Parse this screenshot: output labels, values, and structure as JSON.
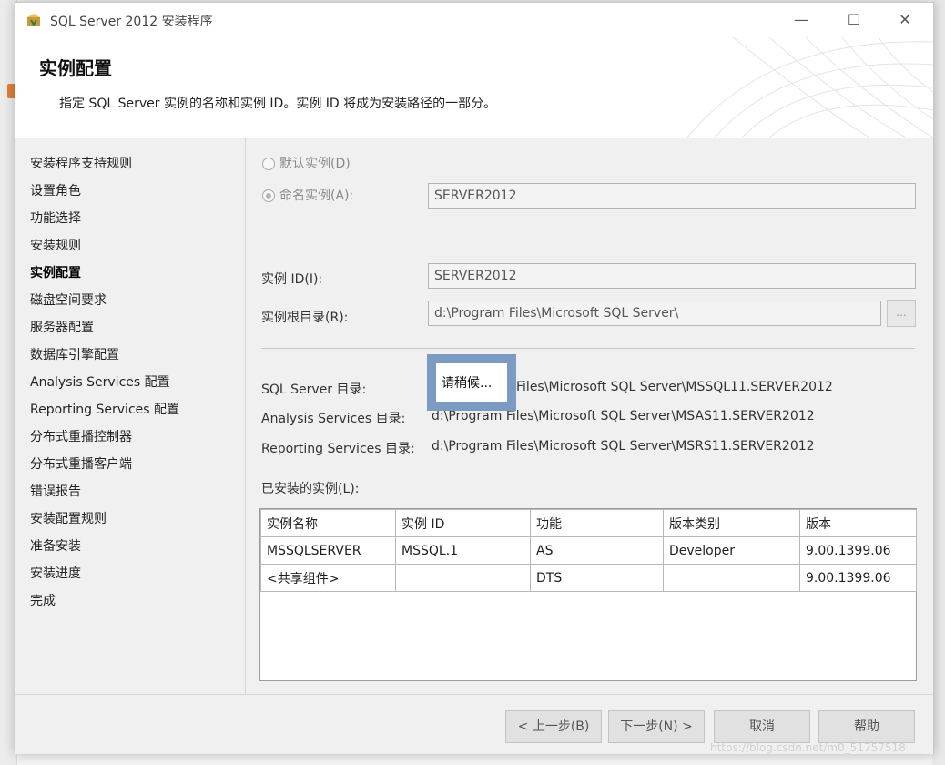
{
  "window": {
    "title": "SQL Server 2012 安装程序",
    "minimize_glyph": "—",
    "maximize_glyph": "☐",
    "close_glyph": "✕"
  },
  "banner": {
    "title": "实例配置",
    "description": "指定 SQL Server 实例的名称和实例 ID。实例 ID 将成为安装路径的一部分。"
  },
  "nav": {
    "items": [
      {
        "label": "安装程序支持规则",
        "active": false
      },
      {
        "label": "设置角色",
        "active": false
      },
      {
        "label": "功能选择",
        "active": false
      },
      {
        "label": "安装规则",
        "active": false
      },
      {
        "label": "实例配置",
        "active": true
      },
      {
        "label": "磁盘空间要求",
        "active": false
      },
      {
        "label": "服务器配置",
        "active": false
      },
      {
        "label": "数据库引擎配置",
        "active": false
      },
      {
        "label": "Analysis Services 配置",
        "active": false
      },
      {
        "label": "Reporting Services 配置",
        "active": false
      },
      {
        "label": "分布式重播控制器",
        "active": false
      },
      {
        "label": "分布式重播客户端",
        "active": false
      },
      {
        "label": "错误报告",
        "active": false
      },
      {
        "label": "安装配置规则",
        "active": false
      },
      {
        "label": "准备安装",
        "active": false
      },
      {
        "label": "安装进度",
        "active": false
      },
      {
        "label": "完成",
        "active": false
      }
    ]
  },
  "instance": {
    "default_label": "默认实例(D)",
    "named_label": "命名实例(A):",
    "named_value": "SERVER2012",
    "id_label": "实例 ID(I):",
    "id_value": "SERVER2012",
    "root_label": "实例根目录(R):",
    "root_value": "d:\\Program Files\\Microsoft SQL Server\\",
    "browse_label": "..."
  },
  "directories": {
    "sql_label": "SQL Server 目录:",
    "sql_value": "Files\\Microsoft SQL Server\\MSSQL11.SERVER2012",
    "as_label": "Analysis Services 目录:",
    "as_value": "d:\\Program Files\\Microsoft SQL Server\\MSAS11.SERVER2012",
    "rs_label": "Reporting Services 目录:",
    "rs_value": "d:\\Program Files\\Microsoft SQL Server\\MSRS11.SERVER2012"
  },
  "busy": {
    "label": "请稍候..."
  },
  "installed": {
    "label": "已安装的实例(L):",
    "columns": [
      "实例名称",
      "实例 ID",
      "功能",
      "版本类别",
      "版本"
    ],
    "rows": [
      [
        "MSSQLSERVER",
        "MSSQL.1",
        "AS",
        "Developer",
        "9.00.1399.06"
      ],
      [
        "<共享组件>",
        "",
        "DTS",
        "",
        "9.00.1399.06"
      ]
    ]
  },
  "footer": {
    "back": "< 上一步(B)",
    "next": "下一步(N) >",
    "cancel": "取消",
    "help": "帮助"
  },
  "watermark": "https://blog.csdn.net/m0_51757518"
}
